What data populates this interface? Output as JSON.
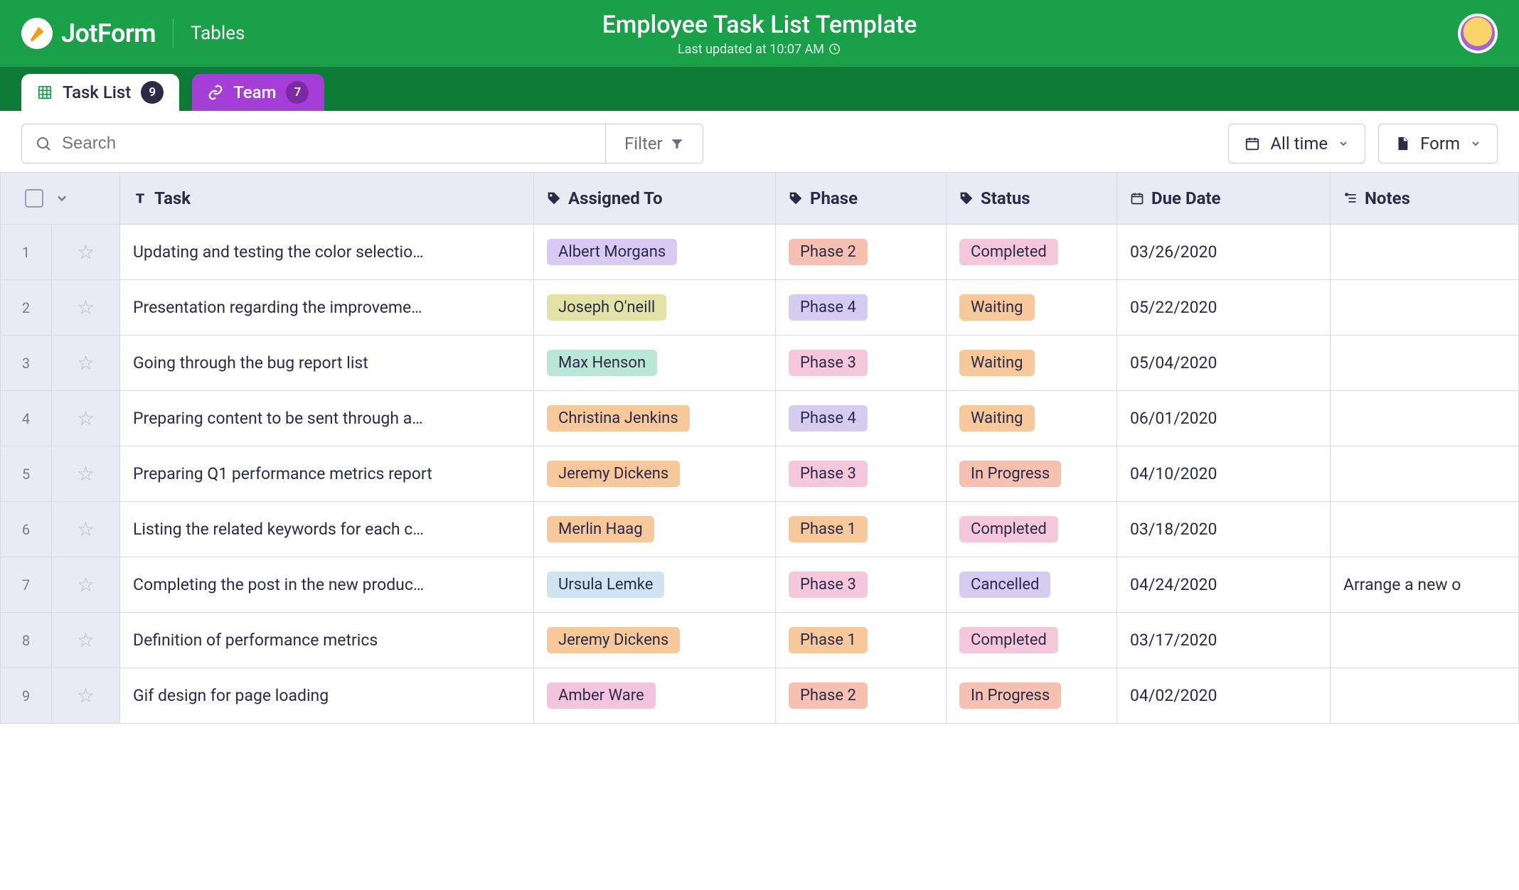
{
  "brand": {
    "name": "JotForm",
    "section": "Tables"
  },
  "header": {
    "title": "Employee Task List Template",
    "updated": "Last updated at 10:07 AM"
  },
  "tabs": [
    {
      "label": "Task List",
      "count": "9"
    },
    {
      "label": "Team",
      "count": "7"
    }
  ],
  "toolbar": {
    "search_placeholder": "Search",
    "filter_label": "Filter",
    "alltime_label": "All time",
    "form_label": "Form"
  },
  "columns": {
    "task": "Task",
    "assigned": "Assigned To",
    "phase": "Phase",
    "status": "Status",
    "due": "Due Date",
    "notes": "Notes"
  },
  "colors": {
    "assignee": {
      "Albert Morgans": "#d8caf2",
      "Joseph O'neill": "#e4e3a7",
      "Max Henson": "#bbe7d7",
      "Christina Jenkins": "#f6c89a",
      "Jeremy Dickens": "#f6c89a",
      "Merlin Haag": "#f6c89a",
      "Ursula Lemke": "#cfe4f0",
      "Amber Ware": "#f3c4dd"
    },
    "phase": {
      "Phase 1": "#f6c89a",
      "Phase 2": "#f6c1b0",
      "Phase 3": "#f5c7da",
      "Phase 4": "#d5ccf0"
    },
    "status": {
      "Completed": "#f5c7da",
      "Waiting": "#f6c89a",
      "In Progress": "#f6c1b0",
      "Cancelled": "#d5ccf0"
    }
  },
  "rows": [
    {
      "n": "1",
      "task": "Updating and testing the color selectio…",
      "assignee": "Albert Morgans",
      "phase": "Phase 2",
      "status": "Completed",
      "due": "03/26/2020",
      "notes": ""
    },
    {
      "n": "2",
      "task": "Presentation regarding the improveme…",
      "assignee": "Joseph O'neill",
      "phase": "Phase 4",
      "status": "Waiting",
      "due": "05/22/2020",
      "notes": ""
    },
    {
      "n": "3",
      "task": "Going through the bug report list",
      "assignee": "Max Henson",
      "phase": "Phase 3",
      "status": "Waiting",
      "due": "05/04/2020",
      "notes": ""
    },
    {
      "n": "4",
      "task": "Preparing content to be sent through a…",
      "assignee": "Christina Jenkins",
      "phase": "Phase 4",
      "status": "Waiting",
      "due": "06/01/2020",
      "notes": ""
    },
    {
      "n": "5",
      "task": "Preparing Q1 performance metrics report",
      "assignee": "Jeremy Dickens",
      "phase": "Phase 3",
      "status": "In Progress",
      "due": "04/10/2020",
      "notes": ""
    },
    {
      "n": "6",
      "task": "Listing the related keywords for each c…",
      "assignee": "Merlin Haag",
      "phase": "Phase 1",
      "status": "Completed",
      "due": "03/18/2020",
      "notes": ""
    },
    {
      "n": "7",
      "task": "Completing the post in the new produc…",
      "assignee": "Ursula Lemke",
      "phase": "Phase 3",
      "status": "Cancelled",
      "due": "04/24/2020",
      "notes": "Arrange a new o"
    },
    {
      "n": "8",
      "task": "Definition of performance metrics",
      "assignee": "Jeremy Dickens",
      "phase": "Phase 1",
      "status": "Completed",
      "due": "03/17/2020",
      "notes": ""
    },
    {
      "n": "9",
      "task": "Gif design for page loading",
      "assignee": "Amber Ware",
      "phase": "Phase 2",
      "status": "In Progress",
      "due": "04/02/2020",
      "notes": ""
    }
  ]
}
